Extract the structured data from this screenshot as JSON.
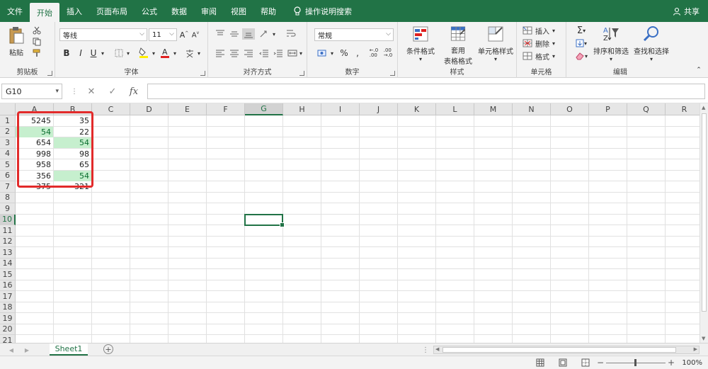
{
  "menu": {
    "tabs": [
      "文件",
      "开始",
      "插入",
      "页面布局",
      "公式",
      "数据",
      "审阅",
      "视图",
      "帮助"
    ],
    "active_index": 1,
    "tell_me": "操作说明搜索",
    "share": "共享"
  },
  "ribbon": {
    "clipboard": {
      "label": "剪贴板",
      "paste": "粘贴"
    },
    "font": {
      "label": "字体",
      "font_name": "等线",
      "font_size": "11",
      "bold": "B",
      "italic": "I",
      "underline": "U"
    },
    "alignment": {
      "label": "对齐方式"
    },
    "number": {
      "label": "数字",
      "format": "常规"
    },
    "styles": {
      "label": "样式",
      "conditional": "条件格式",
      "table_format": "套用",
      "table_format2": "表格格式",
      "cell_styles": "单元格样式"
    },
    "cells": {
      "label": "单元格",
      "insert": "插入",
      "delete": "删除",
      "format": "格式"
    },
    "editing": {
      "label": "编辑",
      "sort_filter": "排序和筛选",
      "find_select": "查找和选择"
    }
  },
  "formula_bar": {
    "name_box": "G10",
    "fx": "fx",
    "value": ""
  },
  "columns": [
    "A",
    "B",
    "C",
    "D",
    "E",
    "F",
    "G",
    "H",
    "I",
    "J",
    "K",
    "L",
    "M",
    "N",
    "O",
    "P",
    "Q",
    "R"
  ],
  "rows": [
    "1",
    "2",
    "3",
    "4",
    "5",
    "6",
    "7",
    "8",
    "9",
    "10",
    "11",
    "12",
    "13",
    "14",
    "15",
    "16",
    "17",
    "18",
    "19",
    "20",
    "21"
  ],
  "selected": {
    "col": "G",
    "row": "10"
  },
  "data": [
    {
      "a": "5245",
      "b": "35"
    },
    {
      "a": "54",
      "b": "22"
    },
    {
      "a": "654",
      "b": "54"
    },
    {
      "a": "998",
      "b": "98"
    },
    {
      "a": "958",
      "b": "65"
    },
    {
      "a": "356",
      "b": "54"
    },
    {
      "a": "375",
      "b": "321"
    }
  ],
  "highlighted": [
    "A2",
    "B3",
    "B6"
  ],
  "sheet": {
    "name": "Sheet1",
    "add": "+"
  },
  "status": {
    "zoom": "100%"
  },
  "colors": {
    "accent": "#217346",
    "highlight_fill": "#c6efce",
    "highlight_text": "#0a6e2e",
    "annotation": "#e22b2b"
  }
}
